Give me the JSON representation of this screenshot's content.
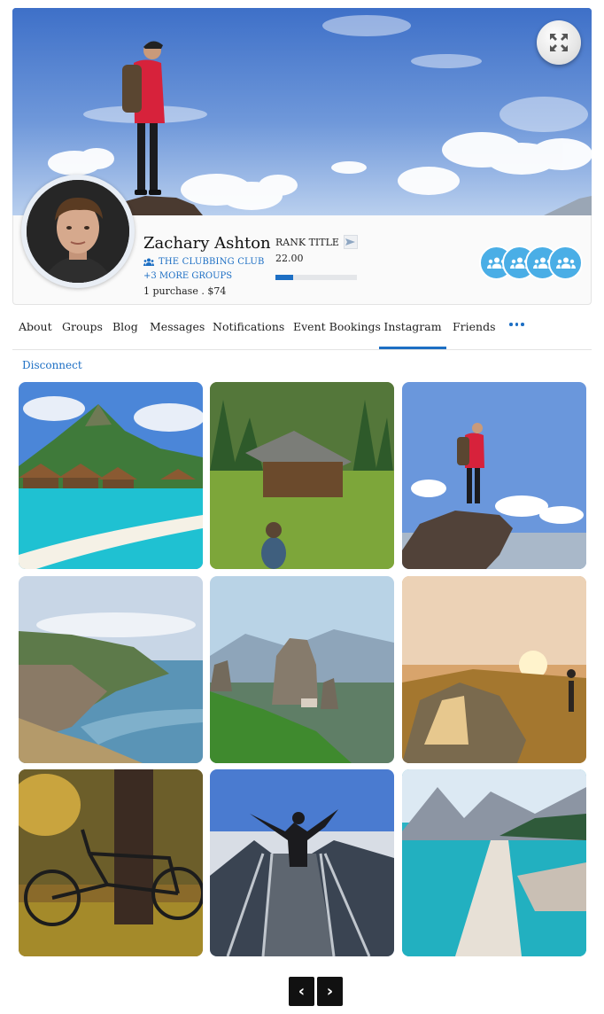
{
  "profile": {
    "name": "Zachary Ashton",
    "club_name": "THE CLUBBING CLUB",
    "more_groups": "+3 MORE GROUPS",
    "purchase_summary": "1 purchase . $74",
    "rank_title": "RANK TITLE",
    "rank_points": "22.00",
    "rank_progress": 0.22
  },
  "tabs": [
    {
      "label": "About"
    },
    {
      "label": "Groups"
    },
    {
      "label": "Blog"
    },
    {
      "label": "Messages"
    },
    {
      "label": "Notifications"
    },
    {
      "label": "Event Bookings"
    },
    {
      "label": "Instagram",
      "active": true
    },
    {
      "label": "Friends"
    }
  ],
  "instagram": {
    "disconnect_label": "Disconnect",
    "photos": [
      "tropical-bungalows",
      "wooden-cabin-meadow",
      "hiker-on-rock",
      "coastal-cliffs",
      "rock-pillars-valley",
      "tent-at-sunset",
      "bicycle-by-tree",
      "person-on-walkway",
      "turquoise-lake-log"
    ]
  },
  "pagination": {
    "prev_label": "‹",
    "next_label": "›"
  },
  "colors": {
    "accent": "#1d6fc4",
    "badge": "#4aaee6"
  }
}
